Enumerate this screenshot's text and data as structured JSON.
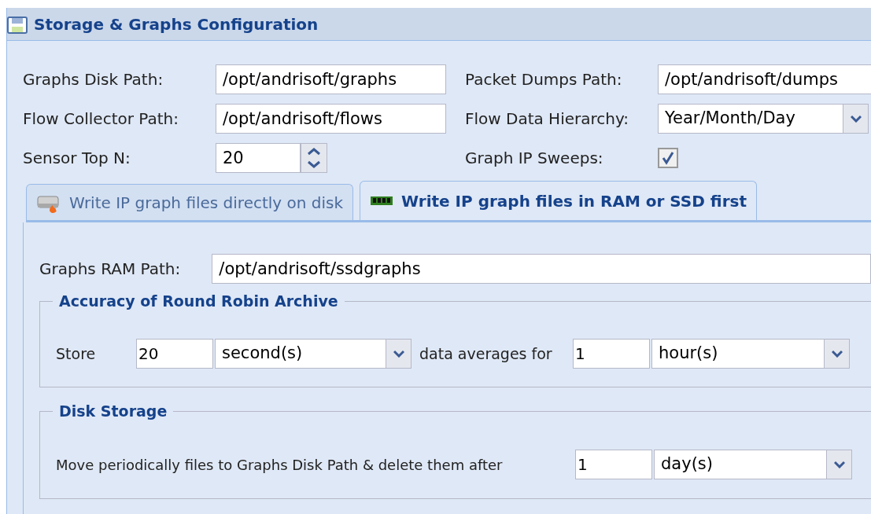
{
  "panel": {
    "title": "Storage & Graphs Configuration"
  },
  "fields": [
    {
      "label": "Graphs Disk Path:",
      "kind": "text",
      "value": "/opt/andrisoft/graphs"
    },
    {
      "label": "Packet Dumps Path:",
      "kind": "text",
      "value": "/opt/andrisoft/dumps"
    },
    {
      "label": "Flow Collector Path:",
      "kind": "text",
      "value": "/opt/andrisoft/flows"
    },
    {
      "label": "Flow Data Hierarchy:",
      "kind": "select",
      "value": "Year/Month/Day"
    },
    {
      "label": "Sensor Top N:",
      "kind": "spinner",
      "value": "20"
    },
    {
      "label": "Graph IP Sweeps:",
      "kind": "checkbox",
      "checked": true
    }
  ],
  "tabs": [
    {
      "label": "Write IP graph files directly on disk",
      "selected": false,
      "kind": "disk"
    },
    {
      "label": "Write IP graph files in RAM or SSD first",
      "selected": true,
      "kind": "ram"
    }
  ],
  "ram_path": {
    "label": "Graphs RAM Path:",
    "value": "/opt/andrisoft/ssdgraphs"
  },
  "accuracy": {
    "legend": "Accuracy of Round Robin Archive",
    "store_label": "Store",
    "store_value": "20",
    "store_unit": "second(s)",
    "middle_label": "data averages for",
    "for_value": "1",
    "for_unit": "hour(s)"
  },
  "disk_storage": {
    "legend": "Disk Storage",
    "text": "Move periodically files to Graphs Disk Path & delete them after",
    "value": "1",
    "unit": "day(s)"
  }
}
